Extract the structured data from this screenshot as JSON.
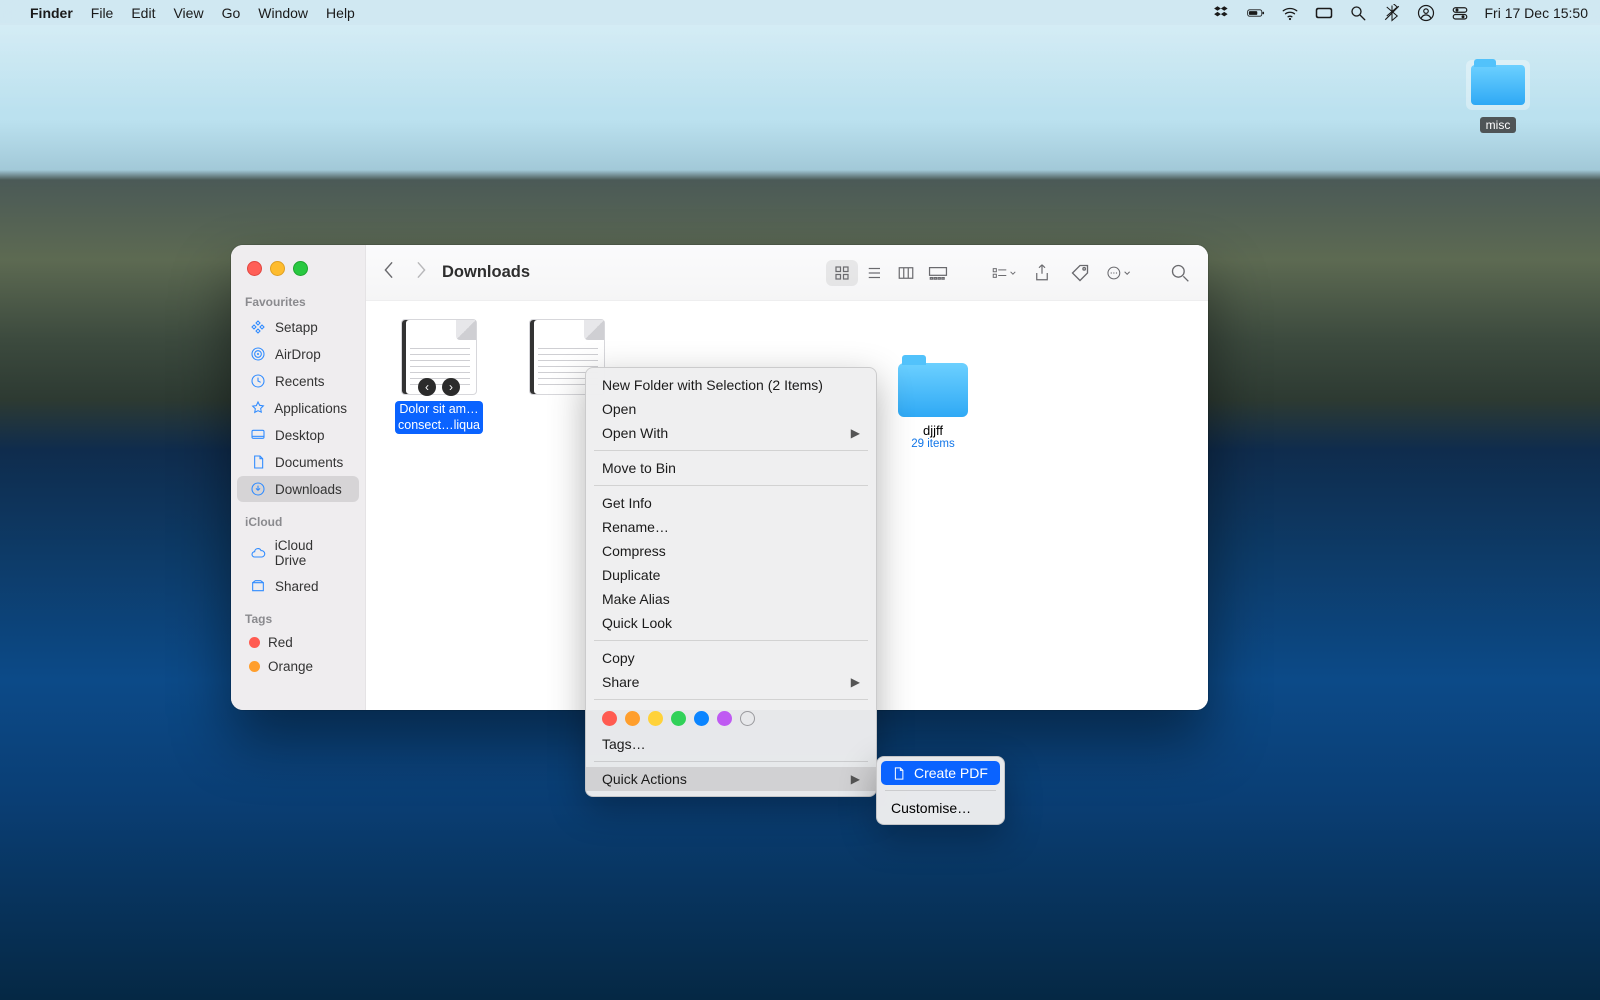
{
  "menubar": {
    "app": "Finder",
    "items": [
      "File",
      "Edit",
      "View",
      "Go",
      "Window",
      "Help"
    ],
    "clock": "Fri 17 Dec  15:50"
  },
  "desktop_item": {
    "label": "misc"
  },
  "finder": {
    "title": "Downloads",
    "sidebar": {
      "favourites_title": "Favourites",
      "favourites": [
        {
          "label": "Setapp"
        },
        {
          "label": "AirDrop"
        },
        {
          "label": "Recents"
        },
        {
          "label": "Applications"
        },
        {
          "label": "Desktop"
        },
        {
          "label": "Documents"
        },
        {
          "label": "Downloads"
        }
      ],
      "icloud_title": "iCloud",
      "icloud": [
        {
          "label": "iCloud Drive"
        },
        {
          "label": "Shared"
        }
      ],
      "tags_title": "Tags",
      "tags": [
        {
          "label": "Red",
          "color": "#ff5b51"
        },
        {
          "label": "Orange",
          "color": "#ff9e2c"
        }
      ]
    },
    "files": {
      "selected1_line1": "Dolor sit am…",
      "selected1_line2": "consect…liqua",
      "folder_name": "djjff",
      "folder_sub": "29 items"
    }
  },
  "context_menu": {
    "new_folder": "New Folder with Selection (2 Items)",
    "open": "Open",
    "open_with": "Open With",
    "move_to_bin": "Move to Bin",
    "get_info": "Get Info",
    "rename": "Rename…",
    "compress": "Compress",
    "duplicate": "Duplicate",
    "make_alias": "Make Alias",
    "quick_look": "Quick Look",
    "copy": "Copy",
    "share": "Share",
    "tags": "Tags…",
    "quick_actions": "Quick Actions",
    "tag_colors": [
      "#ff5b51",
      "#ff9e2c",
      "#ffd23a",
      "#30d158",
      "#0a84ff",
      "#bf5af2"
    ]
  },
  "sub_menu": {
    "create_pdf": "Create PDF",
    "customise": "Customise…"
  }
}
